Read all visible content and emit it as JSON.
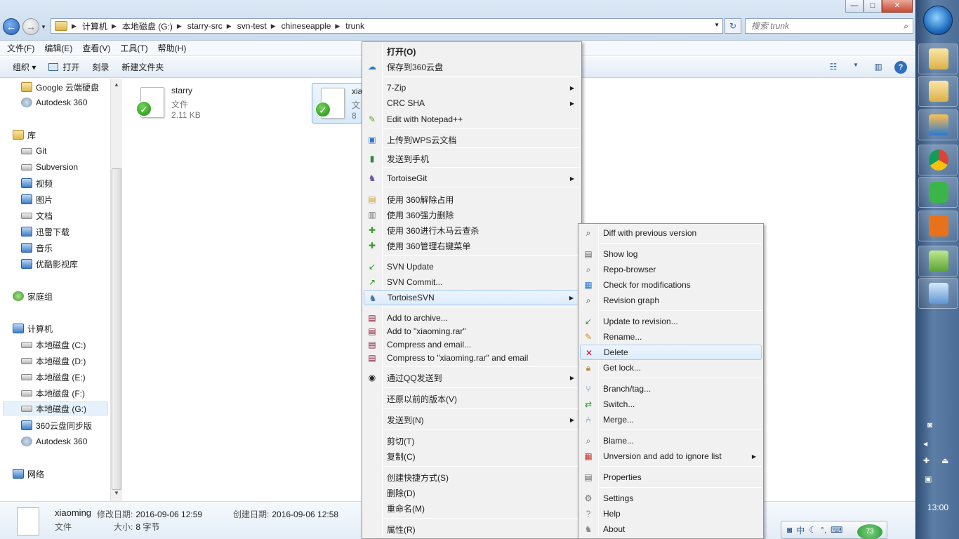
{
  "window": {
    "min_label": "—",
    "max_label": "□",
    "close_label": "✕"
  },
  "address": {
    "crumbs": [
      "计算机",
      "本地磁盘 (G:)",
      "starry-src",
      "svn-test",
      "chineseapple",
      "trunk"
    ]
  },
  "search": {
    "placeholder": "搜索 trunk"
  },
  "menubar": [
    "文件(F)",
    "编辑(E)",
    "查看(V)",
    "工具(T)",
    "帮助(H)"
  ],
  "toolbar": {
    "organize": "组织 ▾",
    "open": "打开",
    "burn": "刻录",
    "new_folder": "新建文件夹",
    "help": "?"
  },
  "nav": [
    {
      "label": "Google 云端硬盘",
      "icon": "folder-icon"
    },
    {
      "label": "Autodesk 360",
      "icon": "cloud-icon"
    },
    {
      "label": "库",
      "icon": "library-icon"
    },
    {
      "label": "Git",
      "icon": "folder-icon"
    },
    {
      "label": "Subversion",
      "icon": "folder-icon"
    },
    {
      "label": "视频",
      "icon": "video-icon"
    },
    {
      "label": "图片",
      "icon": "picture-icon"
    },
    {
      "label": "文档",
      "icon": "document-icon"
    },
    {
      "label": "迅雷下载",
      "icon": "download-icon"
    },
    {
      "label": "音乐",
      "icon": "music-icon"
    },
    {
      "label": "优酷影视库",
      "icon": "video-icon"
    },
    {
      "label": "家庭组",
      "icon": "homegroup-icon"
    },
    {
      "label": "计算机",
      "icon": "computer-icon"
    },
    {
      "label": "本地磁盘 (C:)",
      "icon": "drive-icon"
    },
    {
      "label": "本地磁盘 (D:)",
      "icon": "drive-icon"
    },
    {
      "label": "本地磁盘 (E:)",
      "icon": "drive-icon"
    },
    {
      "label": "本地磁盘 (F:)",
      "icon": "drive-icon"
    },
    {
      "label": "本地磁盘 (G:)",
      "icon": "drive-icon"
    },
    {
      "label": "360云盘同步版",
      "icon": "cloud-icon"
    },
    {
      "label": "Autodesk 360",
      "icon": "cloud-icon"
    },
    {
      "label": "网络",
      "icon": "network-icon"
    }
  ],
  "files": [
    {
      "name": "starry",
      "type": "文件",
      "size": "2.11 KB"
    },
    {
      "name": "xia",
      "type": "文",
      "size": "8"
    }
  ],
  "details": {
    "name": "xiaoming",
    "type": "文件",
    "modified_label": "修改日期:",
    "modified": "2016-09-06 12:59",
    "created_label": "创建日期:",
    "created": "2016-09-06 12:58",
    "size_label": "大小:",
    "size": "8 字节"
  },
  "context_menu": {
    "items": [
      {
        "label": "打开(O)",
        "icon": "",
        "submenu": false
      },
      {
        "label": "保存到360云盘",
        "icon": "cloud-360-icon",
        "submenu": false
      },
      {
        "label": "7-Zip",
        "icon": "",
        "submenu": true
      },
      {
        "label": "CRC SHA",
        "icon": "",
        "submenu": true
      },
      {
        "label": "Edit with Notepad++",
        "icon": "notepad-icon",
        "submenu": false
      },
      {
        "label": "上传到WPS云文档",
        "icon": "wps-icon",
        "submenu": false
      },
      {
        "label": "发送到手机",
        "icon": "phone-icon",
        "submenu": false
      },
      {
        "label": "TortoiseGit",
        "icon": "tortoisegit-icon",
        "submenu": true
      },
      {
        "label": "使用 360解除占用",
        "icon": "unlock-360-icon",
        "submenu": false
      },
      {
        "label": "使用 360强力删除",
        "icon": "shred-360-icon",
        "submenu": false
      },
      {
        "label": "使用 360进行木马云查杀",
        "icon": "scan-360-icon",
        "submenu": false
      },
      {
        "label": "使用 360管理右键菜单",
        "icon": "manage-360-icon",
        "submenu": false
      },
      {
        "label": "SVN Update",
        "icon": "svn-update-icon",
        "submenu": false
      },
      {
        "label": "SVN Commit...",
        "icon": "svn-commit-icon",
        "submenu": false
      },
      {
        "label": "TortoiseSVN",
        "icon": "tortoisesvn-icon",
        "submenu": true
      },
      {
        "label": "Add to archive...",
        "icon": "rar-icon",
        "submenu": false
      },
      {
        "label": "Add to \"xiaoming.rar\"",
        "icon": "rar-icon",
        "submenu": false
      },
      {
        "label": "Compress and email...",
        "icon": "rar-icon",
        "submenu": false
      },
      {
        "label": "Compress to \"xiaoming.rar\" and email",
        "icon": "rar-icon",
        "submenu": false
      },
      {
        "label": "通过QQ发送到",
        "icon": "qq-icon",
        "submenu": true
      },
      {
        "label": "还原以前的版本(V)",
        "icon": "",
        "submenu": false
      },
      {
        "label": "发送到(N)",
        "icon": "",
        "submenu": true
      },
      {
        "label": "剪切(T)",
        "icon": "",
        "submenu": false
      },
      {
        "label": "复制(C)",
        "icon": "",
        "submenu": false
      },
      {
        "label": "创建快捷方式(S)",
        "icon": "",
        "submenu": false
      },
      {
        "label": "删除(D)",
        "icon": "",
        "submenu": false
      },
      {
        "label": "重命名(M)",
        "icon": "",
        "submenu": false
      },
      {
        "label": "属性(R)",
        "icon": "",
        "submenu": false
      }
    ]
  },
  "svn_menu": {
    "items": [
      {
        "label": "Diff with previous version",
        "icon": "diff-icon",
        "submenu": false
      },
      {
        "label": "Show log",
        "icon": "log-icon",
        "submenu": false
      },
      {
        "label": "Repo-browser",
        "icon": "repo-browser-icon",
        "submenu": false
      },
      {
        "label": "Check for modifications",
        "icon": "check-mods-icon",
        "submenu": false
      },
      {
        "label": "Revision graph",
        "icon": "revision-graph-icon",
        "submenu": false
      },
      {
        "label": "Update to revision...",
        "icon": "update-icon",
        "submenu": false
      },
      {
        "label": "Rename...",
        "icon": "rename-icon",
        "submenu": false
      },
      {
        "label": "Delete",
        "icon": "delete-icon",
        "submenu": false
      },
      {
        "label": "Get lock...",
        "icon": "lock-icon",
        "submenu": false
      },
      {
        "label": "Branch/tag...",
        "icon": "branch-icon",
        "submenu": false
      },
      {
        "label": "Switch...",
        "icon": "switch-icon",
        "submenu": false
      },
      {
        "label": "Merge...",
        "icon": "merge-icon",
        "submenu": false
      },
      {
        "label": "Blame...",
        "icon": "blame-icon",
        "submenu": false
      },
      {
        "label": "Unversion and add to ignore list",
        "icon": "ignore-icon",
        "submenu": true
      },
      {
        "label": "Properties",
        "icon": "properties-icon",
        "submenu": false
      },
      {
        "label": "Settings",
        "icon": "settings-icon",
        "submenu": false
      },
      {
        "label": "Help",
        "icon": "help-icon",
        "submenu": false
      },
      {
        "label": "About",
        "icon": "about-icon",
        "submenu": false
      }
    ]
  },
  "ime": {
    "label": "中",
    "badge": "73"
  },
  "taskbar": {
    "clock": "13:00"
  },
  "colors": {
    "highlight": "#dcebfb",
    "accent": "#2f6fbd",
    "delete_red": "#d0021b"
  }
}
